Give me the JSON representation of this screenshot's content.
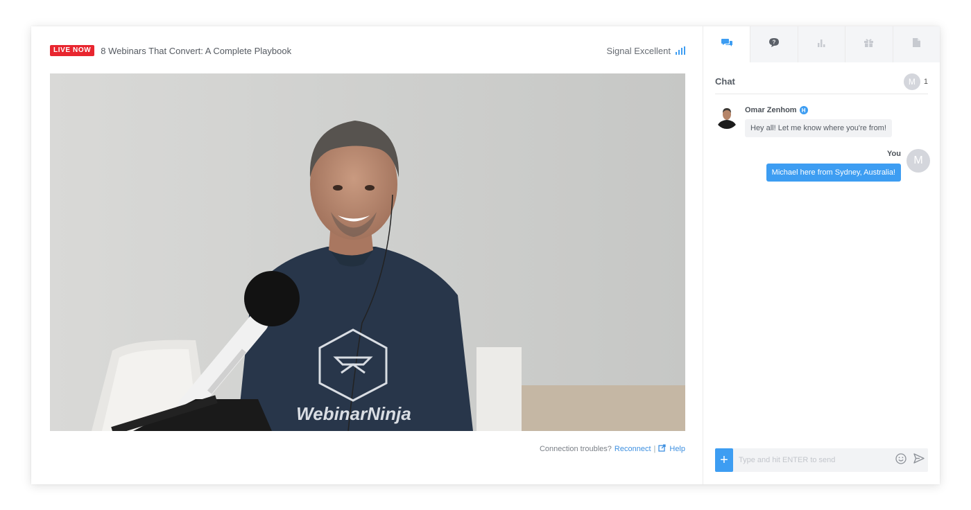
{
  "stream": {
    "live_label": "LIVE NOW",
    "title": "8 Webinars That Convert: A Complete Playbook",
    "signal_text": "Signal Excellent"
  },
  "video": {
    "shirt_text": "WebinarNinja"
  },
  "footer": {
    "prompt": "Connection troubles?",
    "reconnect": "Reconnect",
    "separator": "|",
    "help": "Help"
  },
  "sidebar": {
    "tabs": [
      {
        "icon": "chat-bubbles-icon",
        "active": true
      },
      {
        "icon": "question-bubble-icon",
        "active": false
      },
      {
        "icon": "poll-chart-icon",
        "active": false
      },
      {
        "icon": "gift-icon",
        "active": false
      },
      {
        "icon": "document-icon",
        "active": false
      }
    ],
    "chat_title": "Chat",
    "viewer_initial": "M",
    "viewer_count": "1",
    "messages": [
      {
        "author": "Omar Zenhom",
        "badge": "H",
        "text": "Hey all! Let me know where you're from!",
        "from_me": false
      },
      {
        "author": "You",
        "initial": "M",
        "text": "Michael here from Sydney, Australia!",
        "from_me": true
      }
    ],
    "composer": {
      "plus": "+",
      "placeholder": "Type and hit ENTER to send"
    }
  },
  "colors": {
    "accent": "#3d9df2",
    "live": "#e8262f"
  }
}
